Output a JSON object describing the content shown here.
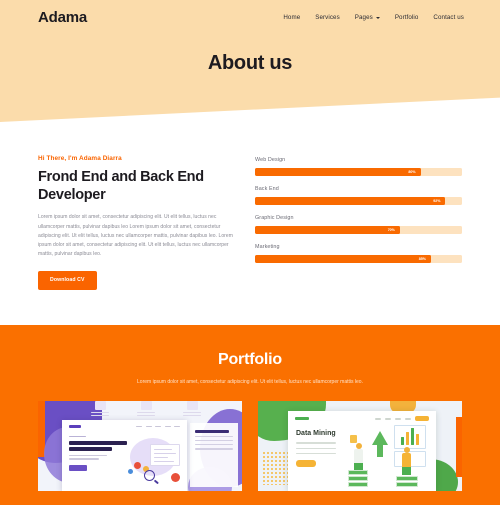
{
  "header": {
    "logo": "Adama",
    "nav": [
      {
        "label": "Home",
        "has_dropdown": false
      },
      {
        "label": "Services",
        "has_dropdown": false
      },
      {
        "label": "Pages",
        "has_dropdown": true
      },
      {
        "label": "Portfolio",
        "has_dropdown": false
      },
      {
        "label": "Contact us",
        "has_dropdown": false
      }
    ],
    "page_title": "About us"
  },
  "about": {
    "tagline": "Hi There, I'm Adama Diarra",
    "heading": "Frond End and Back End Developer",
    "paragraph": "Lorem ipsum dolor sit amet, consectetur adipiscing elit. Ut elit tellus, luctus nec ullamcorper mattis, pulvinar dapibus leo Lorem ipsum dolor sit amet, consectetur adipiscing elit. Ut elit tellus, luctus nec ullamcorper mattis, pulvinar dapibus leo. Lorem ipsum dolor sit amet, consectetur adipiscing elit. Ut elit tellus, luctus nec ullamcorper mattis, pulvinar dapibus leo.",
    "cta_label": "Download CV",
    "skills": [
      {
        "label": "Web Design",
        "percent": 80,
        "percent_label": "80%"
      },
      {
        "label": "Back End",
        "percent": 92,
        "percent_label": "92%"
      },
      {
        "label": "Graphic Design",
        "percent": 70,
        "percent_label": "70%"
      },
      {
        "label": "Marketing",
        "percent": 85,
        "percent_label": "85%"
      }
    ]
  },
  "portfolio": {
    "title": "Portfolio",
    "subtitle": "Lorem ipsum dolor sit amet, consectetur adipiscing elit. Ut elit tellus, luctus nec ullamcorper mattis leo.",
    "cards": [
      {
        "name": "creative-agency-mockup",
        "headline": "We are the Best Professional Creative Agency"
      },
      {
        "name": "data-mining-mockup",
        "headline": "Data Mining"
      }
    ]
  },
  "colors": {
    "hero_bg": "#fbdcab",
    "accent_orange": "#fa6400",
    "portfolio_bg": "#fa7000",
    "text_dark": "#1d1b20",
    "text_muted": "#8a8a94",
    "track": "#fde2bf"
  }
}
